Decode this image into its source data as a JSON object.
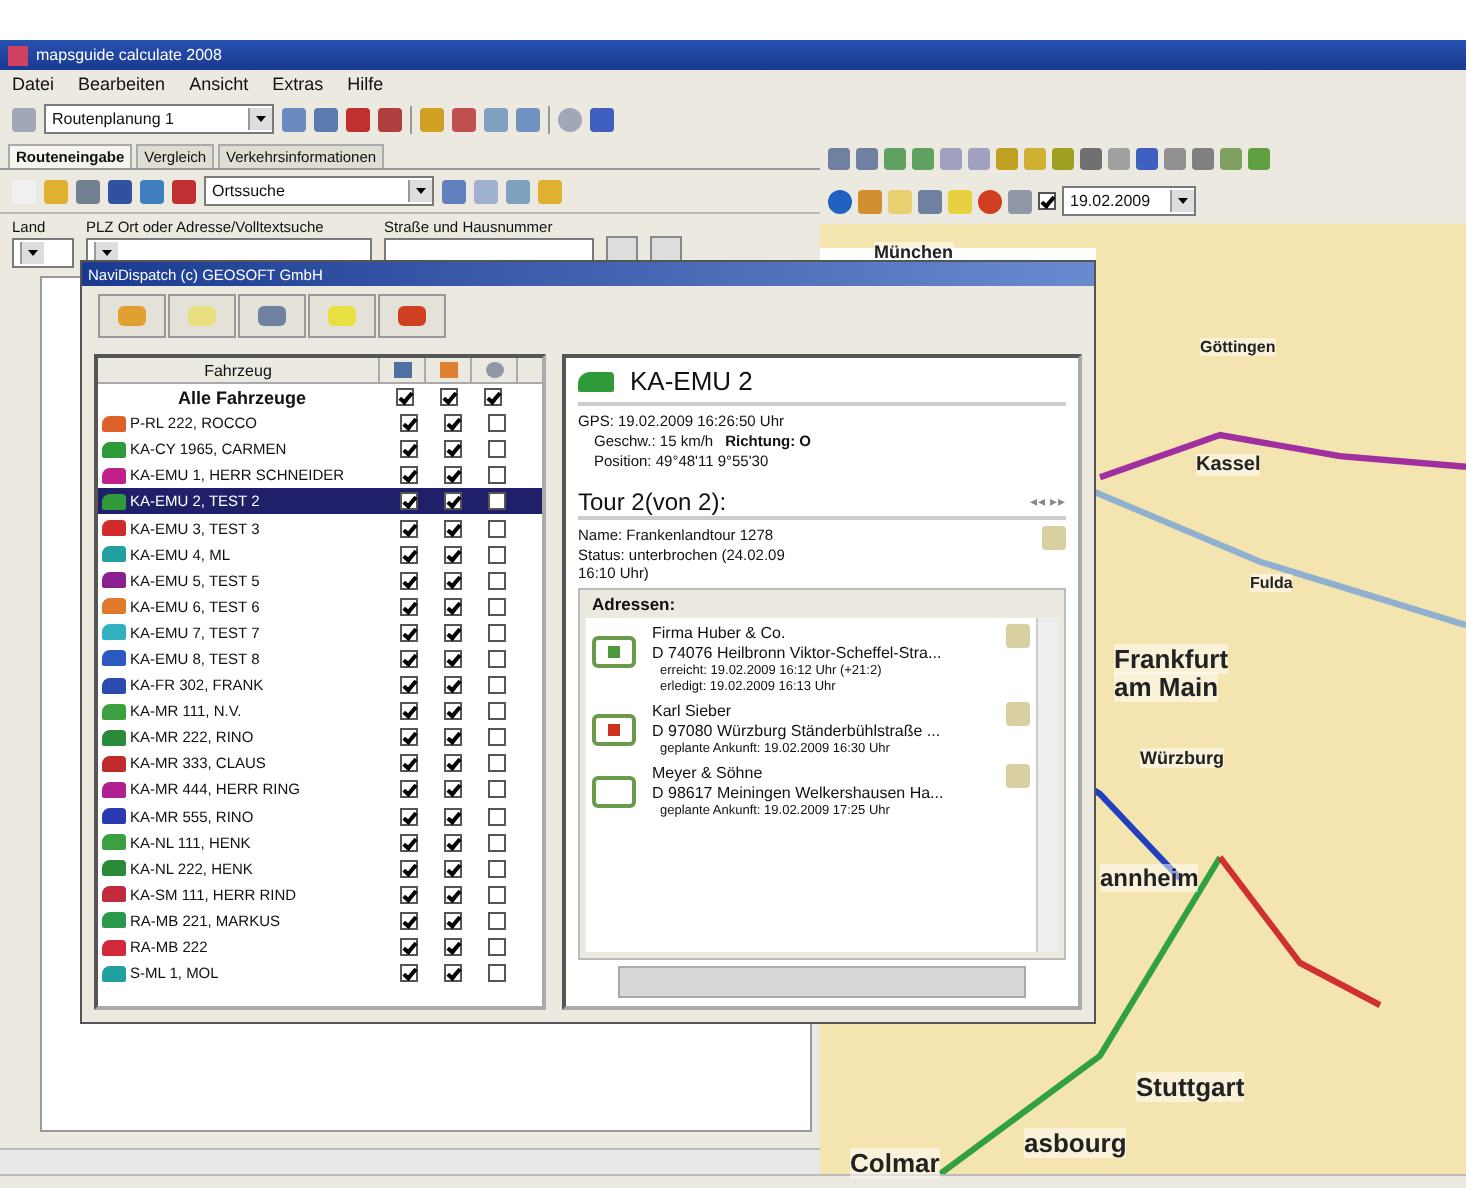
{
  "window": {
    "title": "mapsguide calculate 2008"
  },
  "menu": [
    "Datei",
    "Bearbeiten",
    "Ansicht",
    "Extras",
    "Hilfe"
  ],
  "toolbar": {
    "dropdown": "Routenplanung 1"
  },
  "tabs": [
    {
      "label": "Routeneingabe",
      "selected": true
    },
    {
      "label": "Vergleich",
      "selected": false
    },
    {
      "label": "Verkehrsinformationen",
      "selected": false
    }
  ],
  "search_toolbar": {
    "dropdown": "Ortssuche"
  },
  "search_form": {
    "country_label": "Land",
    "place_label": "PLZ Ort oder Adresse/Volltextsuche",
    "street_label": "Straße und Hausnummer"
  },
  "map_toolbar": {
    "date_checked": true,
    "date": "19.02.2009"
  },
  "map": {
    "labels": [
      "München",
      "Göttingen",
      "Kassel",
      "Fulda",
      "Frankfurt",
      "am Main",
      "Würzburg",
      "annheim",
      "Stuttgart",
      "asbourg",
      "Colmar"
    ]
  },
  "dialog": {
    "title": "NaviDispatch (c) GEOSOFT GmbH",
    "vehicle_list": {
      "column": "Fahrzeug",
      "all_label": "Alle Fahrzeuge",
      "all_checks": [
        true,
        true,
        true
      ],
      "rows": [
        {
          "name": "P-RL 222, ROCCO",
          "color": "#e0602a",
          "checks": [
            true,
            true,
            false
          ],
          "selected": false
        },
        {
          "name": "KA-CY 1965, CARMEN",
          "color": "#2f9a3a",
          "checks": [
            true,
            true,
            false
          ],
          "selected": false
        },
        {
          "name": "KA-EMU 1, HERR SCHNEIDER",
          "color": "#c0208a",
          "checks": [
            true,
            true,
            false
          ],
          "selected": false
        },
        {
          "name": "KA-EMU 2, TEST 2",
          "color": "#2f9a3a",
          "checks": [
            true,
            true,
            false
          ],
          "selected": true
        },
        {
          "name": "KA-EMU 3, TEST 3",
          "color": "#d02a2a",
          "checks": [
            true,
            true,
            false
          ],
          "selected": false
        },
        {
          "name": "KA-EMU 4, ML",
          "color": "#20a0a0",
          "checks": [
            true,
            true,
            false
          ],
          "selected": false
        },
        {
          "name": "KA-EMU 5, TEST 5",
          "color": "#8a2090",
          "checks": [
            true,
            true,
            false
          ],
          "selected": false
        },
        {
          "name": "KA-EMU 6, TEST 6",
          "color": "#e07a2a",
          "checks": [
            true,
            true,
            false
          ],
          "selected": false
        },
        {
          "name": "KA-EMU 7, TEST 7",
          "color": "#30b0c0",
          "checks": [
            true,
            true,
            false
          ],
          "selected": false
        },
        {
          "name": "KA-EMU 8, TEST 8",
          "color": "#2a5ac0",
          "checks": [
            true,
            true,
            false
          ],
          "selected": false
        },
        {
          "name": "KA-FR 302, FRANK",
          "color": "#2a4ab0",
          "checks": [
            true,
            true,
            false
          ],
          "selected": false
        },
        {
          "name": "KA-MR 111, N.V.",
          "color": "#3aa040",
          "checks": [
            true,
            true,
            false
          ],
          "selected": false
        },
        {
          "name": "KA-MR 222, RINO",
          "color": "#2a8a3a",
          "checks": [
            true,
            true,
            false
          ],
          "selected": false
        },
        {
          "name": "KA-MR 333, CLAUS",
          "color": "#c02a2a",
          "checks": [
            true,
            true,
            false
          ],
          "selected": false
        },
        {
          "name": "KA-MR 444, HERR RING",
          "color": "#b02090",
          "checks": [
            true,
            true,
            false
          ],
          "selected": false
        },
        {
          "name": "KA-MR 555, RINO",
          "color": "#2a3ab0",
          "checks": [
            true,
            true,
            false
          ],
          "selected": false
        },
        {
          "name": "KA-NL 111, HENK",
          "color": "#3aa040",
          "checks": [
            true,
            true,
            false
          ],
          "selected": false
        },
        {
          "name": "KA-NL 222, HENK",
          "color": "#2a8a3a",
          "checks": [
            true,
            true,
            false
          ],
          "selected": false
        },
        {
          "name": "KA-SM 111, HERR RIND",
          "color": "#c02a3a",
          "checks": [
            true,
            true,
            false
          ],
          "selected": false
        },
        {
          "name": "RA-MB 221, MARKUS",
          "color": "#2a9a4a",
          "checks": [
            true,
            true,
            false
          ],
          "selected": false
        },
        {
          "name": "RA-MB 222",
          "color": "#d02a3a",
          "checks": [
            true,
            true,
            false
          ],
          "selected": false
        },
        {
          "name": "S-ML 1, MOL",
          "color": "#20a0a0",
          "checks": [
            true,
            true,
            false
          ],
          "selected": false
        }
      ]
    },
    "detail": {
      "vehicle": "KA-EMU 2",
      "gps": "GPS: 19.02.2009 16:26:50 Uhr",
      "speed": "Geschw.: 15 km/h",
      "direction": "Richtung: O",
      "position": "Position: 49°48'11  9°55'30",
      "tour_title": "Tour 2(von 2):",
      "tour_nav": "◂◂ ▸▸",
      "tour_name": "Name: Frankenlandtour 1278",
      "tour_status": "Status: unterbrochen  (24.02.09 16:10 Uhr)",
      "addresses_title": "Adressen:",
      "addresses": [
        {
          "kind": "done",
          "name": "Firma Huber & Co.",
          "address": "D 74076 Heilbronn Viktor-Scheffel-Stra...",
          "lines": [
            "erreicht:  19.02.2009 16:12 Uhr (+21:2)",
            "erledigt:  19.02.2009 16:13 Uhr"
          ]
        },
        {
          "kind": "active",
          "name": "Karl Sieber",
          "address": "D 97080 Würzburg Ständerbühlstraße ...",
          "lines": [
            "geplante Ankunft:  19.02.2009 16:30 Uhr"
          ]
        },
        {
          "kind": "planned",
          "name": "Meyer & Söhne",
          "address": "D 98617 Meiningen Welkershausen Ha...",
          "lines": [
            "geplante Ankunft:  19.02.2009 17:25 Uhr"
          ]
        }
      ]
    }
  }
}
